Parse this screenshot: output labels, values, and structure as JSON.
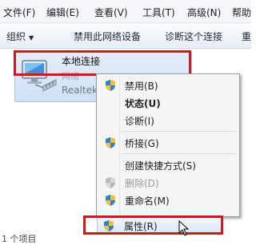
{
  "menubar": {
    "items": [
      "文件(F)",
      "编辑(E)",
      "查看(V)",
      "工具(T)",
      "高级(N)",
      "帮助"
    ]
  },
  "toolbar": {
    "organize": "组织",
    "disable_device": "禁用此网络设备",
    "diagnose": "诊断这个连接",
    "rename_partial": "重"
  },
  "connection": {
    "name": "本地连接",
    "network": "网络",
    "adapter": "Realtek"
  },
  "context_menu": {
    "items": [
      {
        "label": "禁用(B)",
        "icon": "shield-icon"
      },
      {
        "label": "状态(U)",
        "bold": true
      },
      {
        "label": "诊断(I)"
      },
      {
        "label": "桥接(G)",
        "icon": "shield-icon"
      },
      {
        "label": "创建快捷方式(S)"
      },
      {
        "label": "删除(D)",
        "icon": "shield-icon",
        "disabled": true
      },
      {
        "label": "重命名(M)",
        "icon": "shield-icon"
      },
      {
        "label": "属性(R)",
        "icon": "shield-icon",
        "highlighted": true
      }
    ]
  },
  "status": {
    "partial_text": "1 个项目"
  },
  "colors": {
    "highlight_box": "#c91c1c",
    "menu_hover": "#dbe8f9",
    "tile": "#cfe0f6"
  }
}
